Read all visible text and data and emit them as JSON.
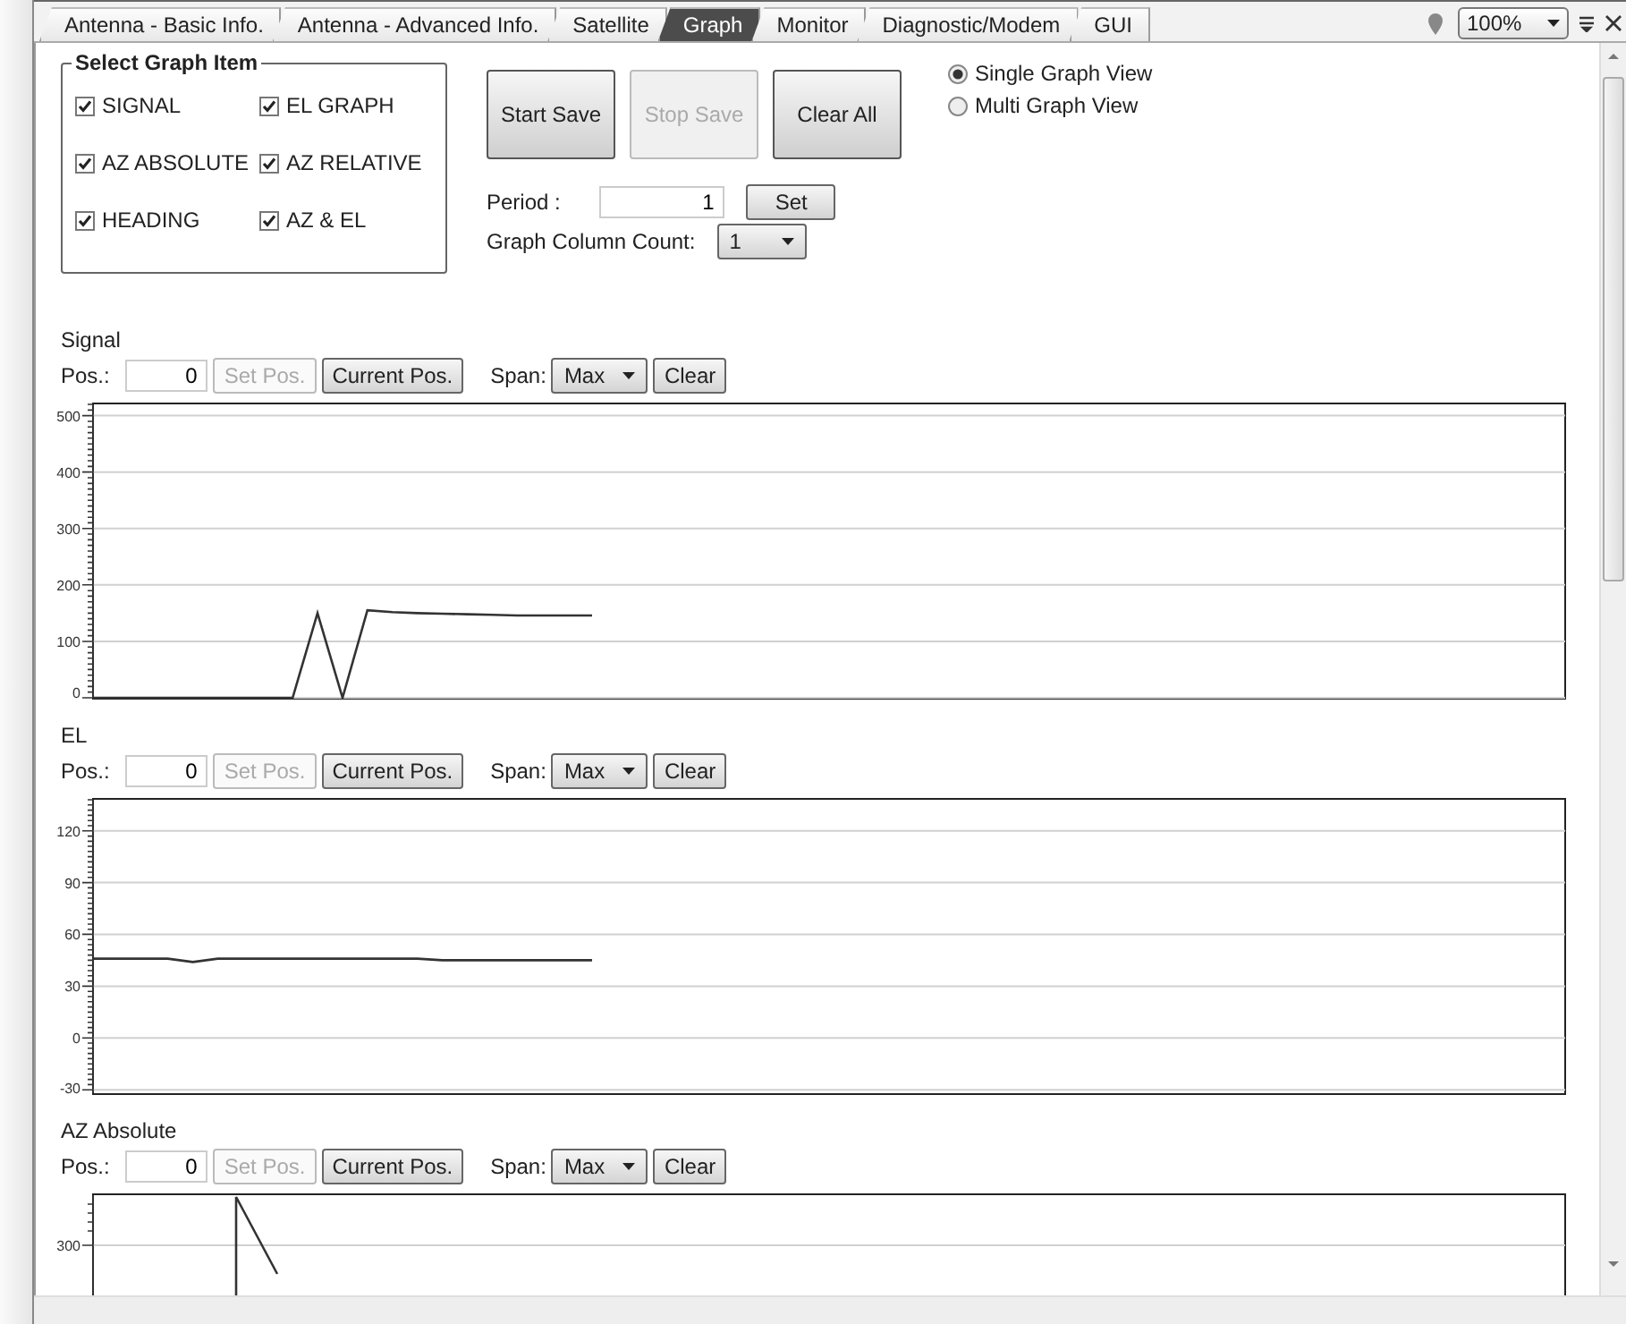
{
  "tabs": [
    {
      "label": "Antenna - Basic Info.",
      "selected": false
    },
    {
      "label": "Antenna - Advanced Info.",
      "selected": false
    },
    {
      "label": "Satellite",
      "selected": false
    },
    {
      "label": "Graph",
      "selected": true
    },
    {
      "label": "Monitor",
      "selected": false
    },
    {
      "label": "Diagnostic/Modem",
      "selected": false
    },
    {
      "label": "GUI",
      "selected": false
    }
  ],
  "toolbar": {
    "zoom": "100%"
  },
  "select_graph_item": {
    "title": "Select Graph Item",
    "items": [
      {
        "label": "SIGNAL",
        "checked": true
      },
      {
        "label": "EL GRAPH",
        "checked": true
      },
      {
        "label": "AZ ABSOLUTE",
        "checked": true
      },
      {
        "label": "AZ RELATIVE",
        "checked": true
      },
      {
        "label": "HEADING",
        "checked": true
      },
      {
        "label": "AZ & EL",
        "checked": true
      }
    ]
  },
  "buttons": [
    {
      "label": "Start Save",
      "disabled": false
    },
    {
      "label": "Stop Save",
      "disabled": true
    },
    {
      "label": "Clear All",
      "disabled": false
    }
  ],
  "view_mode": [
    {
      "label": "Single Graph View",
      "selected": true
    },
    {
      "label": "Multi Graph View",
      "selected": false
    }
  ],
  "period": {
    "label": "Period :",
    "value": "1",
    "button": "Set"
  },
  "column_count": {
    "label": "Graph Column Count:",
    "value": "1"
  },
  "graphs": [
    {
      "pos_label": "Pos.:",
      "pos_value": "0",
      "set_pos": {
        "label": "Set Pos.",
        "disabled": true
      },
      "current_pos": "Current Pos.",
      "span_label": "Span:",
      "span_value": "Max",
      "clear": "Clear",
      "chart_data": {
        "type": "line",
        "title": "Signal",
        "grid": true,
        "ylim": [
          0,
          520
        ],
        "yticks": [
          0,
          100,
          200,
          300,
          400,
          500
        ],
        "categories": [
          null,
          null,
          null,
          null,
          null,
          null,
          null,
          null,
          null,
          null,
          null,
          null,
          null,
          null,
          null,
          null,
          null,
          null,
          null,
          null,
          null,
          null,
          null,
          null,
          null,
          null,
          null,
          null,
          null,
          null,
          null,
          null,
          null,
          null,
          null,
          null,
          null,
          null,
          null,
          null,
          null,
          null,
          null,
          null,
          null,
          null,
          null,
          null,
          null,
          null,
          null,
          null,
          null,
          null,
          null,
          null,
          null,
          null,
          null,
          null
        ],
        "series": [
          {
            "color": "#333333",
            "values": [
              0,
              0,
              0,
              0,
              0,
              0,
              0,
              0,
              0,
              150,
              0,
              155,
              152,
              150,
              149,
              148,
              147,
              146,
              146,
              146,
              146,
              null,
              null,
              null,
              null,
              null,
              null,
              null,
              null,
              null,
              null,
              null,
              null,
              null,
              null,
              null,
              null,
              null,
              null,
              null,
              null,
              null,
              null,
              null,
              null,
              null,
              null,
              null,
              null,
              null,
              null,
              null,
              null,
              null,
              null,
              null,
              null,
              null,
              null,
              null
            ]
          }
        ]
      }
    },
    {
      "pos_label": "Pos.:",
      "pos_value": "0",
      "set_pos": {
        "label": "Set Pos.",
        "disabled": true
      },
      "current_pos": "Current Pos.",
      "span_label": "Span:",
      "span_value": "Max",
      "clear": "Clear",
      "chart_data": {
        "type": "line",
        "title": "EL",
        "grid": true,
        "ylim": [
          -32,
          138
        ],
        "yticks": [
          -30,
          0,
          30,
          60,
          90,
          120
        ],
        "categories": [
          null,
          null,
          null,
          null,
          null,
          null,
          null,
          null,
          null,
          null,
          null,
          null,
          null,
          null,
          null,
          null,
          null,
          null,
          null,
          null,
          null,
          null,
          null,
          null,
          null,
          null,
          null,
          null,
          null,
          null,
          null,
          null,
          null,
          null,
          null,
          null,
          null,
          null,
          null,
          null,
          null,
          null,
          null,
          null,
          null,
          null,
          null,
          null,
          null,
          null,
          null,
          null,
          null,
          null,
          null,
          null,
          null,
          null,
          null,
          null
        ],
        "series": [
          {
            "color": "#333333",
            "values": [
              46,
              46,
              46,
              46,
              44,
              46,
              46,
              46,
              46,
              46,
              46,
              46,
              46,
              46,
              45,
              45,
              45,
              45,
              45,
              45,
              45,
              null,
              null,
              null,
              null,
              null,
              null,
              null,
              null,
              null,
              null,
              null,
              null,
              null,
              null,
              null,
              null,
              null,
              null,
              null,
              null,
              null,
              null,
              null,
              null,
              null,
              null,
              null,
              null,
              null,
              null,
              null,
              null,
              null,
              null,
              null,
              null,
              null,
              null,
              null
            ]
          }
        ]
      }
    },
    {
      "title": "AZ Absolute",
      "pos_label": "Pos.:",
      "pos_value": "0",
      "set_pos": {
        "label": "Set Pos.",
        "disabled": true
      },
      "current_pos": "Current Pos.",
      "span_label": "Span:",
      "span_value": "Max",
      "clear": "Clear",
      "axis_labels": [
        "300"
      ]
    }
  ]
}
